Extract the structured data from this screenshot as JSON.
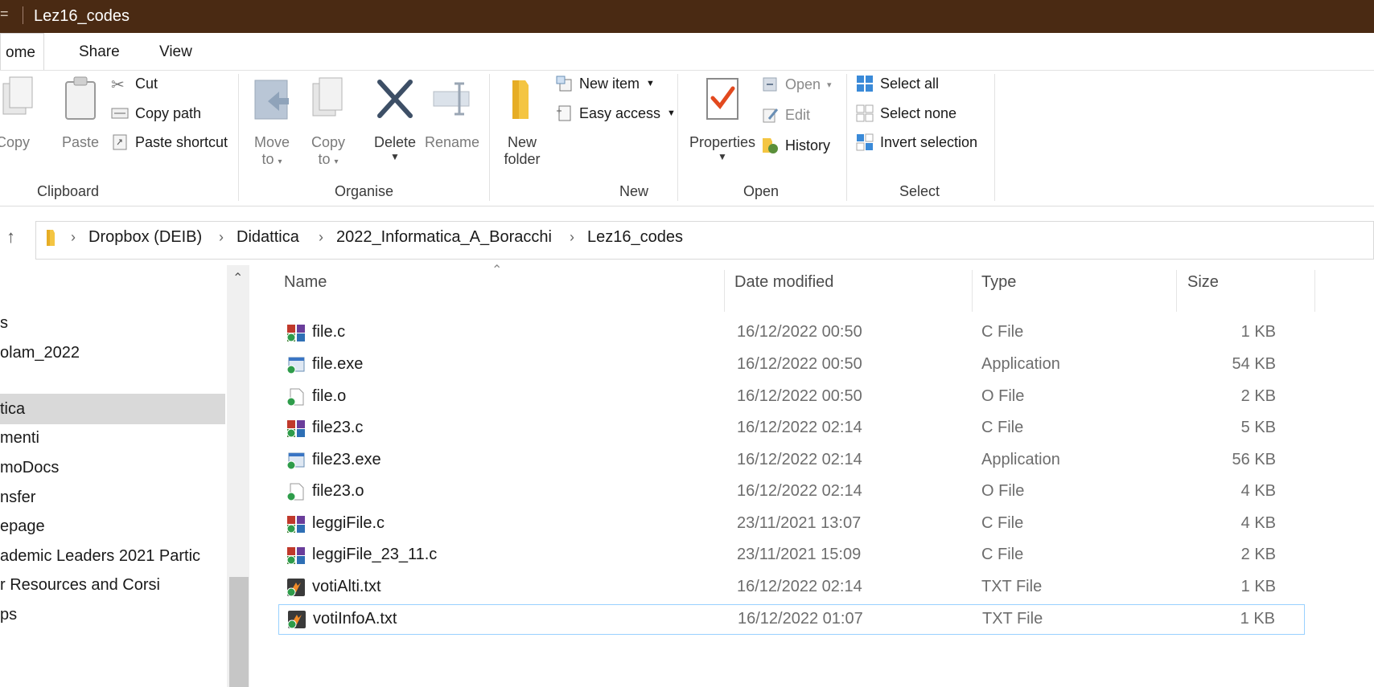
{
  "window": {
    "title": "Lez16_codes",
    "title_prefix": "="
  },
  "ribbon_tabs": {
    "home": "ome",
    "share": "Share",
    "view": "View"
  },
  "clipboard": {
    "copy": "Copy",
    "paste": "Paste",
    "cut": "Cut",
    "copy_path": "Copy path",
    "paste_shortcut": "Paste shortcut",
    "group": "Clipboard"
  },
  "organise": {
    "move_to_1": "Move",
    "move_to_2": "to",
    "copy_to_1": "Copy",
    "copy_to_2": "to",
    "delete": "Delete",
    "rename": "Rename",
    "group": "Organise"
  },
  "new_group": {
    "new_folder_1": "New",
    "new_folder_2": "folder",
    "new_item": "New item",
    "easy_access": "Easy access",
    "group": "New"
  },
  "open_group": {
    "properties": "Properties",
    "open": "Open",
    "edit": "Edit",
    "history": "History",
    "group": "Open"
  },
  "select_group": {
    "select_all": "Select all",
    "select_none": "Select none",
    "invert_selection": "Invert selection",
    "group": "Select"
  },
  "breadcrumb": [
    "Dropbox (DEIB)",
    "Didattica",
    "2022_Informatica_A_Boracchi",
    "Lez16_codes"
  ],
  "nav_items": [
    "s",
    "olam_2022",
    "tica",
    "menti",
    "moDocs",
    "nsfer",
    "epage",
    "ademic Leaders 2021 Partic",
    "r Resources and Corsi",
    "ps"
  ],
  "columns": {
    "name": "Name",
    "date": "Date modified",
    "type": "Type",
    "size": "Size"
  },
  "files": [
    {
      "name": "file.c",
      "date": "16/12/2022 00:50",
      "type": "C File",
      "size": "1 KB",
      "icon": "c-file-icon"
    },
    {
      "name": "file.exe",
      "date": "16/12/2022 00:50",
      "type": "Application",
      "size": "54 KB",
      "icon": "exe-file-icon"
    },
    {
      "name": "file.o",
      "date": "16/12/2022 00:50",
      "type": "O File",
      "size": "2 KB",
      "icon": "o-file-icon"
    },
    {
      "name": "file23.c",
      "date": "16/12/2022 02:14",
      "type": "C File",
      "size": "5 KB",
      "icon": "c-file-icon"
    },
    {
      "name": "file23.exe",
      "date": "16/12/2022 02:14",
      "type": "Application",
      "size": "56 KB",
      "icon": "exe-file-icon"
    },
    {
      "name": "file23.o",
      "date": "16/12/2022 02:14",
      "type": "O File",
      "size": "4 KB",
      "icon": "o-file-icon"
    },
    {
      "name": "leggiFile.c",
      "date": "23/11/2021 13:07",
      "type": "C File",
      "size": "4 KB",
      "icon": "c-file-icon"
    },
    {
      "name": "leggiFile_23_11.c",
      "date": "23/11/2021 15:09",
      "type": "C File",
      "size": "2 KB",
      "icon": "c-file-icon"
    },
    {
      "name": "votiAlti.txt",
      "date": "16/12/2022 02:14",
      "type": "TXT File",
      "size": "1 KB",
      "icon": "txt-file-icon"
    },
    {
      "name": "votiInfoA.txt",
      "date": "16/12/2022 01:07",
      "type": "TXT File",
      "size": "1 KB",
      "icon": "txt-file-icon"
    }
  ],
  "colors": {
    "title_bar": "#4a2a13",
    "selection_border": "#99d1ff",
    "nav_selected": "#d9d9d9"
  }
}
